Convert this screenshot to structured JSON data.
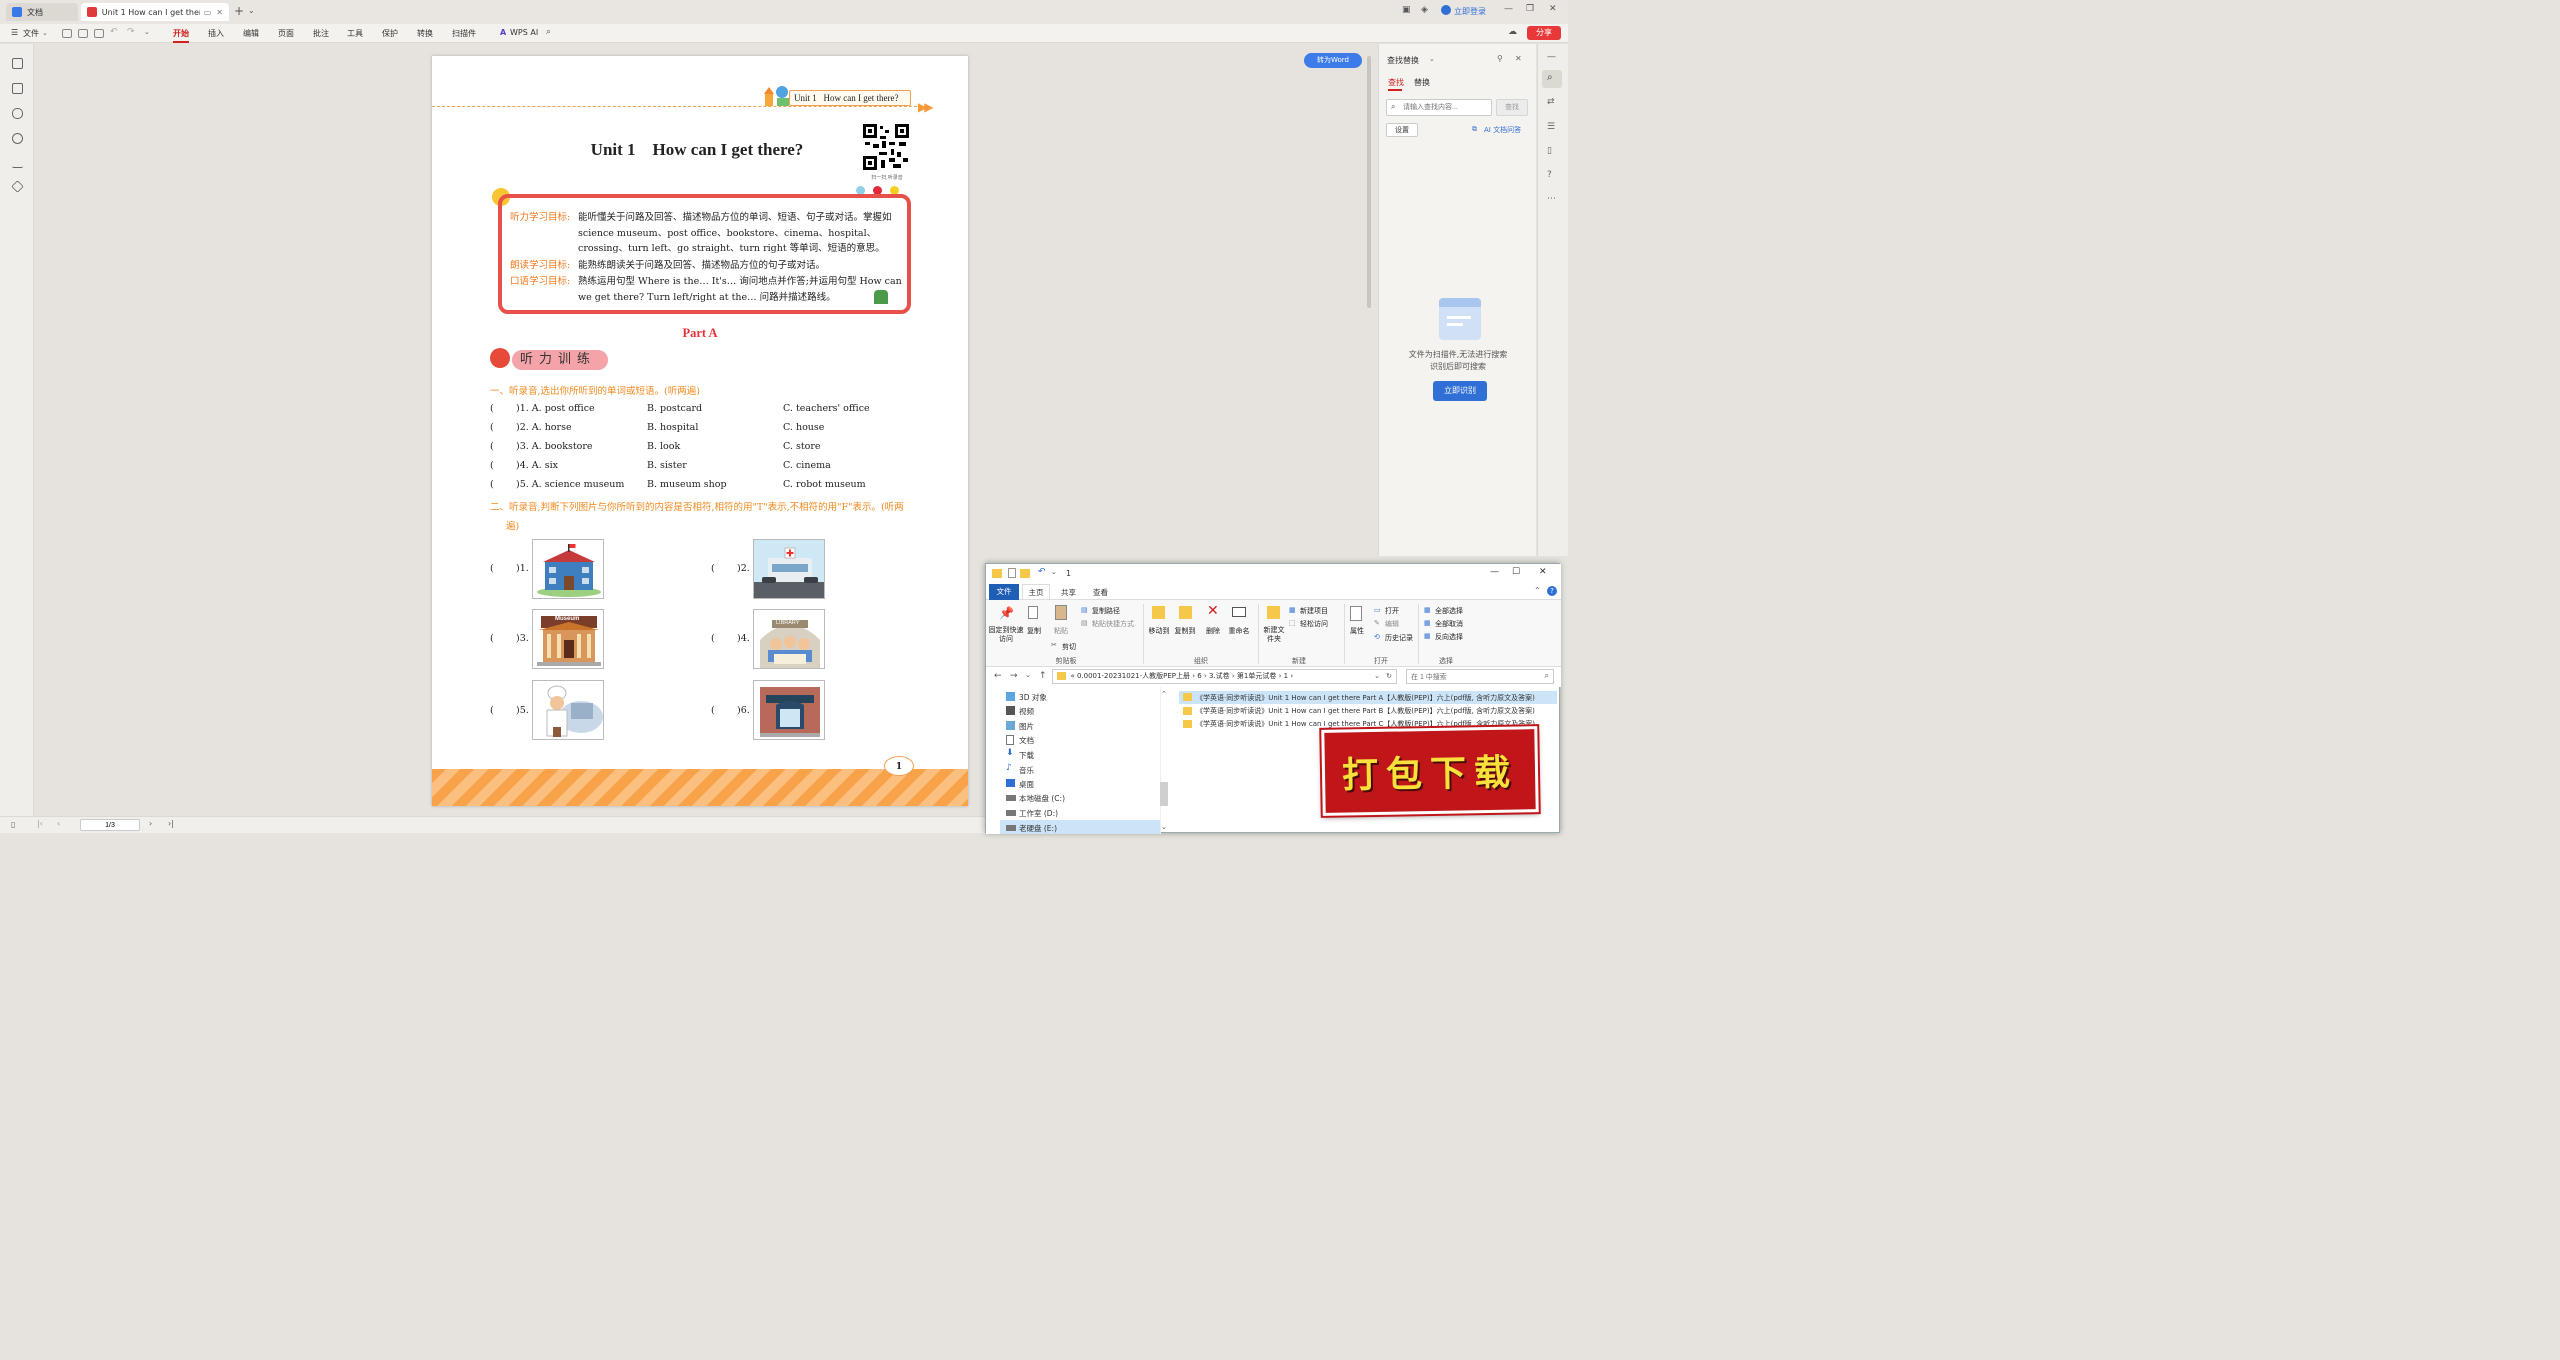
{
  "titlebar": {
    "tabs": [
      {
        "label": "文档",
        "active": false
      },
      {
        "label": "Unit 1 How can I get there",
        "active": true
      }
    ],
    "login": "立即登录"
  },
  "menubar": {
    "file": "文件",
    "items": [
      "开始",
      "插入",
      "编辑",
      "页面",
      "批注",
      "工具",
      "保护",
      "转换",
      "扫描件"
    ],
    "active": "开始",
    "wps_ai": "WPS AI",
    "share": "分享"
  },
  "document": {
    "to_word": "转为Word",
    "header_unit": "Unit 1",
    "header_title": "How can I get there?",
    "title": "Unit 1    How can I get there?",
    "qr_caption": "扫一扫,听录音",
    "goals": [
      {
        "label": "听力学习目标:",
        "text": "能听懂关于问路及回答、描述物品方位的单词、短语、句子或对话。掌握如 science museum、post office、bookstore、cinema、hospital、crossing、turn left、go straight、turn right 等单词、短语的意思。"
      },
      {
        "label": "朗读学习目标:",
        "text": "能熟练朗读关于问路及回答、描述物品方位的句子或对话。"
      },
      {
        "label": "口语学习目标:",
        "text": "熟练运用句型 Where is the… It's… 询问地点并作答;并运用句型 How can we get there? Turn left/right at the… 问路并描述路线。"
      }
    ],
    "part": "Part A",
    "section_title": "听力训练",
    "q1_heading": "一、听录音,选出你所听到的单词或短语。(听两遍)",
    "q1_rows": [
      {
        "n": ")1. A. post office",
        "b": "B. postcard",
        "c": "C. teachers' office"
      },
      {
        "n": ")2. A. horse",
        "b": "B. hospital",
        "c": "C. house"
      },
      {
        "n": ")3. A. bookstore",
        "b": "B. look",
        "c": "C. store"
      },
      {
        "n": ")4. A. six",
        "b": "B. sister",
        "c": "C. cinema"
      },
      {
        "n": ")5. A. science museum",
        "b": "B. museum shop",
        "c": "C. robot museum"
      }
    ],
    "q2_heading": "二、听录音,判断下列图片与你所听到的内容是否相符,相符的用\"T\"表示,不相符的用\"F\"表示。(听两遍)",
    "q2_items": [
      ")1.",
      ")2.",
      ")3.",
      ")4.",
      ")5.",
      ")6."
    ],
    "museum_sign": "Museum",
    "library_sign": "LIBRARY",
    "page_number": "1"
  },
  "bottombar": {
    "page_indicator": "1/3"
  },
  "rightpanel": {
    "title": "查找替换",
    "tab_find": "查找",
    "tab_replace": "替换",
    "search_placeholder": "请输入查找内容...",
    "search_button": "查找",
    "settings": "设置",
    "ai_link": "AI 文档问答",
    "empty_line1": "文件为扫描件,无法进行搜索",
    "empty_line2": "识别后即可搜索",
    "recognize_button": "立即识别"
  },
  "explorer": {
    "title": "1",
    "tabs": [
      "文件",
      "主页",
      "共享",
      "查看"
    ],
    "active_tab": "主页",
    "groups": {
      "clipboard": {
        "label": "剪贴板",
        "pin": "固定到快速访问",
        "copy": "复制",
        "paste": "粘贴",
        "copy_path": "复制路径",
        "paste_shortcut": "粘贴快捷方式",
        "cut": "剪切"
      },
      "organize": {
        "label": "组织",
        "move_to": "移动到",
        "copy_to": "复制到",
        "delete": "删除",
        "rename": "重命名"
      },
      "new": {
        "label": "新建",
        "new_folder": "新建文件夹",
        "new_item": "新建项目",
        "easy_access": "轻松访问"
      },
      "open": {
        "label": "打开",
        "properties": "属性",
        "open": "打开",
        "edit": "编辑",
        "history": "历史记录"
      },
      "select": {
        "label": "选择",
        "select_all": "全部选择",
        "select_none": "全部取消",
        "invert": "反向选择"
      }
    },
    "breadcrumb": [
      "0.0001-20231021-人教版PEP上册",
      "6",
      "3.试卷",
      "第1单元试卷",
      "1"
    ],
    "search_placeholder": "在 1 中搜索",
    "nav_items": [
      "3D 对象",
      "视频",
      "图片",
      "文档",
      "下载",
      "音乐",
      "桌面",
      "本地磁盘 (C:)",
      "工作室 (D:)",
      "老硬盘 (E:)"
    ],
    "files": [
      "《学英语·同步听读说》Unit 1 How can I get there Part A【人教版(PEP)】六上(pdf版, 含听力原文及答案)",
      "《学英语·同步听读说》Unit 1 How can I get there Part B【人教版(PEP)】六上(pdf版, 含听力原文及答案)",
      "《学英语·同步听读说》Unit 1 How can I get there Part C【人教版(PEP)】六上(pdf版, 含听力原文及答案)"
    ]
  },
  "download_banner": "打包下载"
}
